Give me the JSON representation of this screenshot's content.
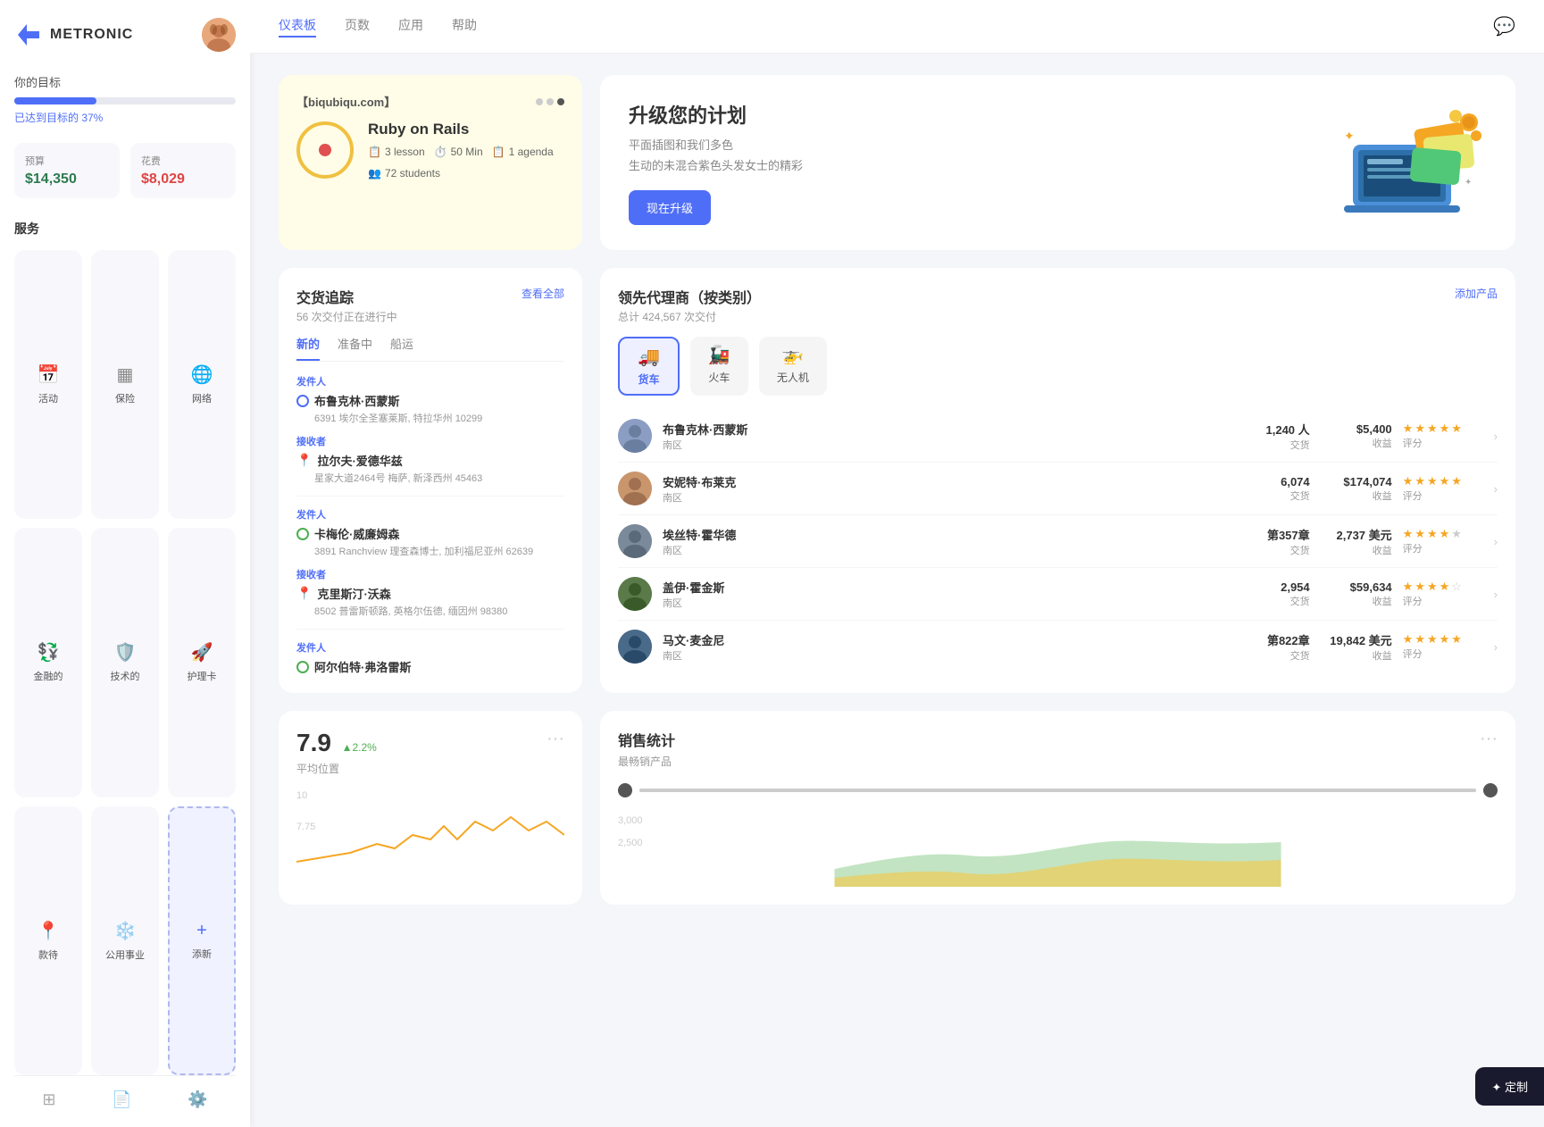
{
  "sidebar": {
    "brand": "METRONIC",
    "goal": {
      "label": "你的目标",
      "percent": 37,
      "percent_text": "已达到目标的 37%"
    },
    "budget": {
      "label": "预算",
      "amount": "$14,350",
      "spent_label": "花费",
      "spent_amount": "$8,029"
    },
    "services_label": "服务",
    "services": [
      {
        "id": "activity",
        "name": "活动",
        "icon": "📅"
      },
      {
        "id": "insurance",
        "name": "保险",
        "icon": "📊"
      },
      {
        "id": "network",
        "name": "网络",
        "icon": "🌐"
      },
      {
        "id": "finance",
        "name": "金融的",
        "icon": "💱"
      },
      {
        "id": "tech",
        "name": "技术的",
        "icon": "🛡️"
      },
      {
        "id": "care",
        "name": "护理卡",
        "icon": "🚀"
      },
      {
        "id": "reception",
        "name": "款待",
        "icon": "📍"
      },
      {
        "id": "public",
        "name": "公用事业",
        "icon": "❄️"
      },
      {
        "id": "add",
        "name": "添新",
        "icon": "+"
      }
    ],
    "footer_icons": [
      "layers",
      "file",
      "settings"
    ]
  },
  "topnav": {
    "links": [
      {
        "label": "仪表板",
        "active": true
      },
      {
        "label": "页数",
        "active": false
      },
      {
        "label": "应用",
        "active": false
      },
      {
        "label": "帮助",
        "active": false
      }
    ]
  },
  "course_card": {
    "url": "【biqubiqu.com】",
    "title": "Ruby on Rails",
    "lessons": "3 lesson",
    "duration": "50 Min",
    "agenda": "1 agenda",
    "students": "72 students"
  },
  "upgrade_card": {
    "title": "升级您的计划",
    "desc_line1": "平面插图和我们多色",
    "desc_line2": "生动的未混合紫色头发女士的精彩",
    "button": "现在升级"
  },
  "delivery": {
    "title": "交货追踪",
    "subtitle": "56 次交付正在进行中",
    "view_all": "查看全部",
    "tabs": [
      "新的",
      "准备中",
      "船运"
    ],
    "active_tab": 0,
    "items": [
      {
        "sender_label": "发件人",
        "sender_name": "布鲁克林·西蒙斯",
        "sender_addr": "6391 埃尔全圣塞莱斯, 特拉华州 10299",
        "receiver_label": "接收者",
        "receiver_name": "拉尔夫·爱德华兹",
        "receiver_addr": "星家大道2464号 梅萨, 新泽西州 45463"
      },
      {
        "sender_label": "发件人",
        "sender_name": "卡梅伦·威廉姆森",
        "sender_addr": "3891 Ranchview 理查森博士, 加利福尼亚州 62639",
        "receiver_label": "接收者",
        "receiver_name": "克里斯汀·沃森",
        "receiver_addr": "8502 普雷斯顿路, 英格尔伍德, 缅因州 98380"
      },
      {
        "sender_label": "发件人",
        "sender_name": "阿尔伯特·弗洛雷斯",
        "sender_addr": ""
      }
    ]
  },
  "agents": {
    "title": "领先代理商（按类别）",
    "subtitle": "总计 424,567 次交付",
    "add_button": "添加产品",
    "categories": [
      {
        "id": "truck",
        "label": "货车",
        "active": true
      },
      {
        "id": "train",
        "label": "火车",
        "active": false
      },
      {
        "id": "drone",
        "label": "无人机",
        "active": false
      }
    ],
    "agents": [
      {
        "name": "布鲁克林·西蒙斯",
        "region": "南区",
        "transactions": "1,240 人",
        "transaction_label": "交货",
        "revenue": "$5,400",
        "revenue_label": "收益",
        "rating": 5,
        "rating_label": "评分",
        "avatar_color": "#8b9dc3"
      },
      {
        "name": "安妮特·布莱克",
        "region": "南区",
        "transactions": "6,074",
        "transaction_label": "交货",
        "revenue": "$174,074",
        "revenue_label": "收益",
        "rating": 5,
        "rating_label": "评分",
        "avatar_color": "#c9956c"
      },
      {
        "name": "埃丝特·霍华德",
        "region": "南区",
        "transactions": "第357章",
        "transaction_label": "交货",
        "revenue": "2,737 美元",
        "revenue_label": "收益",
        "rating": 4.5,
        "rating_label": "评分",
        "avatar_color": "#7a8a9a"
      },
      {
        "name": "盖伊·霍金斯",
        "region": "南区",
        "transactions": "2,954",
        "transaction_label": "交货",
        "revenue": "$59,634",
        "revenue_label": "收益",
        "rating": 4,
        "rating_label": "评分",
        "avatar_color": "#5a7a4a"
      },
      {
        "name": "马文·麦金尼",
        "region": "南区",
        "transactions": "第822章",
        "transaction_label": "交货",
        "revenue": "19,842 美元",
        "revenue_label": "收益",
        "rating": 5,
        "rating_label": "评分",
        "avatar_color": "#4a6a8a"
      }
    ]
  },
  "avg_location": {
    "value": "7.9",
    "change": "▲2.2%",
    "label": "平均位置",
    "chart_labels": [
      "10",
      "7.75"
    ],
    "dots_icon": "..."
  },
  "sales_stats": {
    "title": "销售统计",
    "subtitle": "最畅销产品",
    "dots_icon": "..."
  },
  "customize_btn": "✦ 定制"
}
